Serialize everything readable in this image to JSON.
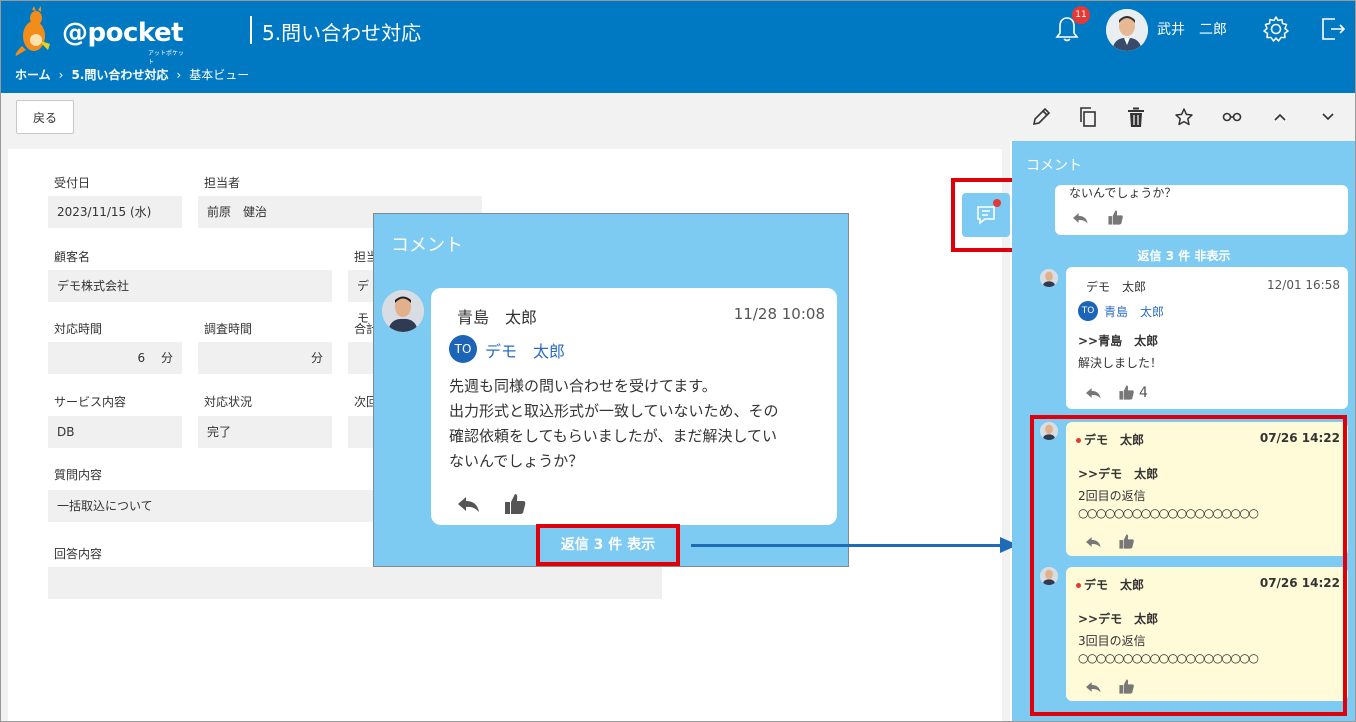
{
  "header": {
    "logo_text": "@pocket",
    "logo_sub": "アットポケット",
    "page_title": "5.問い合わせ対応",
    "notification_count": "11",
    "user_name": "武井　二郎",
    "breadcrumb": [
      "ホーム",
      "5.問い合わせ対応",
      "基本ビュー"
    ],
    "breadcrumb_sep": "›"
  },
  "toolbar": {
    "back_label": "戻る",
    "icons": [
      "pencil-icon",
      "copy-icon",
      "trash-icon",
      "star-icon",
      "glasses-icon",
      "chevron-up-icon",
      "chevron-down-icon"
    ]
  },
  "form": {
    "received_date_label": "受付日",
    "received_date": "2023/11/15 (水)",
    "assignee_label": "担当者",
    "assignee": "前原　健治",
    "customer_label": "顧客名",
    "customer": "デモ株式会社",
    "assignee2_label": "担当",
    "assignee2_value": "デモ",
    "time_label": "対応時間",
    "time_value": "6",
    "time_unit": "分",
    "research_label": "調査時間",
    "research_value": "",
    "research_unit": "分",
    "total_label": "合計",
    "service_label": "サービス内容",
    "service": "DB",
    "status_label": "対応状況",
    "status": "完了",
    "next_label": "次回",
    "question_label": "質問内容",
    "question": "一括取込について",
    "answer_label": "回答内容",
    "answer": ""
  },
  "popup": {
    "title": "コメント",
    "author": "青島　太郎",
    "time": "11/28 10:08",
    "to_initials": "TO",
    "to_name": "デモ　太郎",
    "body": [
      "先週も同様の問い合わせを受けてます。",
      "出力形式と取込形式が一致していないため、その",
      "確認依頼をしてもらいましたが、まだ解決してい",
      "ないんでしょうか？"
    ],
    "reply_link": "返信 3 件 表示"
  },
  "panel": {
    "title": "コメント",
    "top_snippet": "ないんでしょうか？",
    "reply_status": "返信 3 件 非表示",
    "comments": [
      {
        "author": "デモ　太郎",
        "time": "12/01 16:58",
        "to_initials": "TO",
        "to_name": "青島　太郎",
        "quote": ">>青島　太郎",
        "text": "解決しました！",
        "likes": "4"
      },
      {
        "author": "デモ　太郎",
        "time": "07/26 14:22",
        "quote": ">>デモ　太郎",
        "text": "2回目の返信",
        "text2": "○○○○○○○○○○○○○○○○○○○○"
      },
      {
        "author": "デモ　太郎",
        "time": "07/26 14:22",
        "quote": ">>デモ　太郎",
        "text": "3回目の返信",
        "text2": "○○○○○○○○○○○○○○○○○○○○"
      }
    ]
  },
  "colors": {
    "header": "#0079c2",
    "panel": "#7dcaf3",
    "highlight": "#e0000a",
    "unread": "#fffbd8"
  }
}
